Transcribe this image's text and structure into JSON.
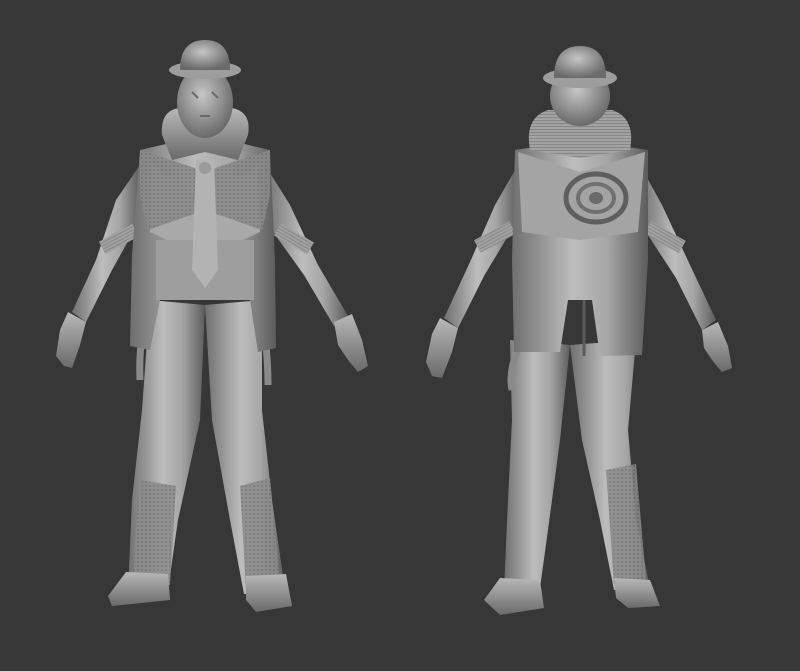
{
  "scene": {
    "background": "#373737",
    "clay_light": "#c9c9c9",
    "clay_mid": "#8f8f8f",
    "clay_dark": "#4a4a4a",
    "views": [
      "front",
      "back"
    ]
  }
}
